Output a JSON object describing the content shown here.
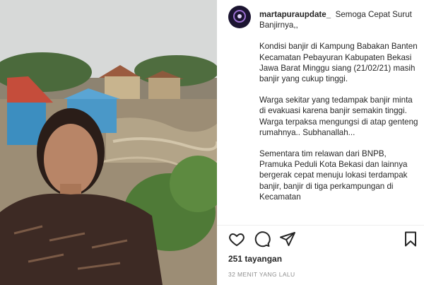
{
  "post": {
    "username": "martapuraupdate_",
    "caption_intro": "Semoga Cepat Surut Banjirnya,,",
    "paragraphs": [
      "Kondisi banjir di Kampung Babakan Banten Kecamatan Pebayuran Kabupaten Bekasi Jawa Barat Minggu siang (21/02/21) masih banjir yang cukup tinggi.",
      "Warga sekitar yang tedampak banjir minta di evakuasi karena banjir semakin tinggi. Warga terpaksa mengungsi di atap genteng rumahnya.. Subhanallah...",
      "Sementara tim relawan dari BNPB, Pramuka Peduli Kota Bekasi dan lainnya bergerak cepat menuju lokasi terdampak banjir, banjir di tiga perkampungan di Kecamatan"
    ]
  },
  "actions": {
    "like_icon": "heart-outline-icon",
    "comment_icon": "comment-bubble-icon",
    "share_icon": "paper-plane-icon",
    "save_icon": "bookmark-icon"
  },
  "stats": {
    "views": "251 tayangan",
    "timestamp": "32 MENIT YANG LALU"
  },
  "colors": {
    "text": "#262626",
    "muted": "#8e8e8e",
    "divider": "#efefef"
  }
}
